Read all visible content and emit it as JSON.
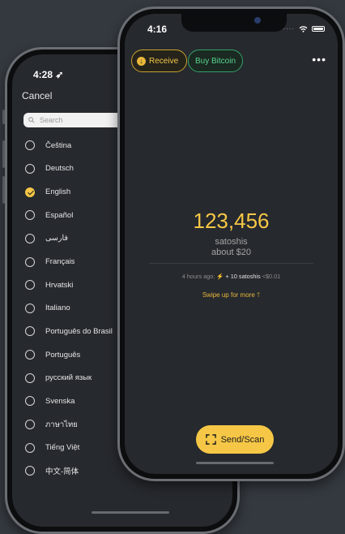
{
  "left_screen": {
    "status_time": "4:28 ➶",
    "cancel_label": "Cancel",
    "search_placeholder": "Search",
    "languages": [
      {
        "label": "Čeština",
        "selected": false
      },
      {
        "label": "Deutsch",
        "selected": false
      },
      {
        "label": "English",
        "selected": true
      },
      {
        "label": "Español",
        "selected": false
      },
      {
        "label": "فارسی",
        "selected": false
      },
      {
        "label": "Français",
        "selected": false
      },
      {
        "label": "Hrvatski",
        "selected": false
      },
      {
        "label": "Italiano",
        "selected": false
      },
      {
        "label": "Português do Brasil",
        "selected": false
      },
      {
        "label": "Português",
        "selected": false
      },
      {
        "label": "русский язык",
        "selected": false
      },
      {
        "label": "Svenska",
        "selected": false
      },
      {
        "label": "ภาษาไทย",
        "selected": false
      },
      {
        "label": "Tiếng Việt",
        "selected": false
      },
      {
        "label": "中文-简体",
        "selected": false
      }
    ]
  },
  "right_screen": {
    "status_time": "4:16",
    "receive_label": "Receive",
    "buy_label": "Buy Bitcoin",
    "menu_icon": "ellipsis-icon",
    "balance": "123,456",
    "unit": "satoshis",
    "fiat": "about $20",
    "activity": {
      "time": "4 hours ago:",
      "bolt_icon": "⚡",
      "amount": "+ 10 satoshis",
      "fiat": "<$0.01"
    },
    "swipe_text": "Swipe up for more 🡑",
    "send_label": "Send/Scan"
  },
  "colors": {
    "accent_yellow": "#f6c746",
    "accent_green": "#57d391",
    "background": "#34393f",
    "screen": "#26292e"
  }
}
